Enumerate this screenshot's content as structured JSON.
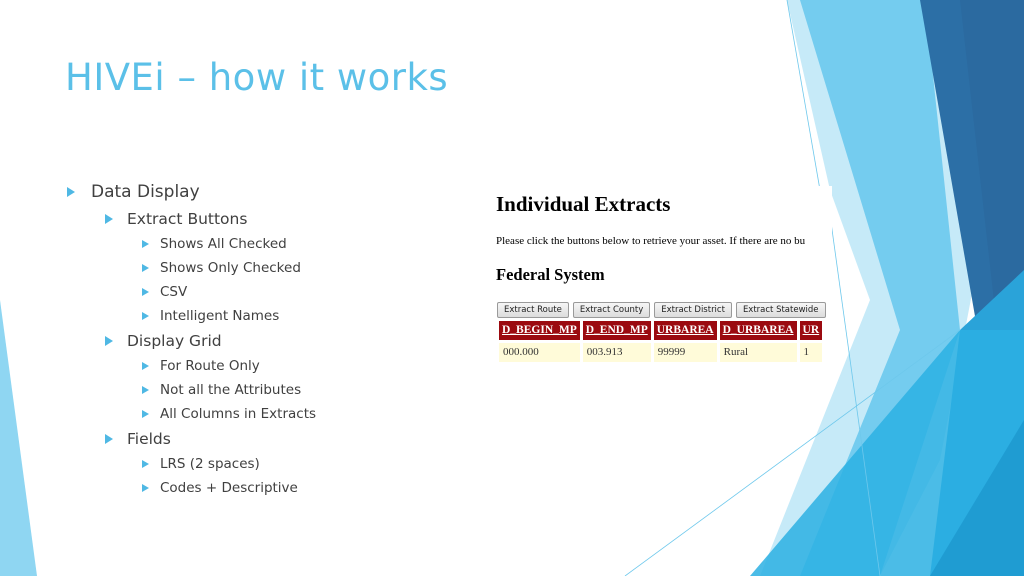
{
  "slide": {
    "title": "HIVEi – how it works"
  },
  "bullets": [
    {
      "level": 1,
      "text": "Data Display"
    },
    {
      "level": 2,
      "text": "Extract Buttons"
    },
    {
      "level": 3,
      "text": "Shows All Checked"
    },
    {
      "level": 3,
      "text": "Shows Only Checked"
    },
    {
      "level": 3,
      "text": "CSV"
    },
    {
      "level": 3,
      "text": "Intelligent Names"
    },
    {
      "level": 2,
      "text": "Display Grid"
    },
    {
      "level": 3,
      "text": "For Route Only"
    },
    {
      "level": 3,
      "text": "Not all the Attributes"
    },
    {
      "level": 3,
      "text": "All Columns in Extracts"
    },
    {
      "level": 2,
      "text": "Fields"
    },
    {
      "level": 3,
      "text": "LRS (2 spaces)"
    },
    {
      "level": 3,
      "text": "Codes + Descriptive"
    }
  ],
  "screenshot": {
    "heading": "Individual Extracts",
    "instructions": "Please click the buttons below to retrieve your asset. If there are no bu",
    "section": "Federal System",
    "buttons": [
      "Extract Route",
      "Extract County",
      "Extract District",
      "Extract Statewide"
    ],
    "table": {
      "columns": [
        "D_BEGIN_MP",
        "D_END_MP",
        "URBAREA",
        "D_URBAREA",
        "UR"
      ],
      "rows": [
        [
          "000.000",
          "003.913",
          "99999",
          "Rural",
          "1"
        ]
      ]
    }
  },
  "colors": {
    "title": "#5bc0e8",
    "bullet": "#4fb8e4",
    "table_header": "#9b0a10",
    "table_cell": "#fffbd9"
  }
}
